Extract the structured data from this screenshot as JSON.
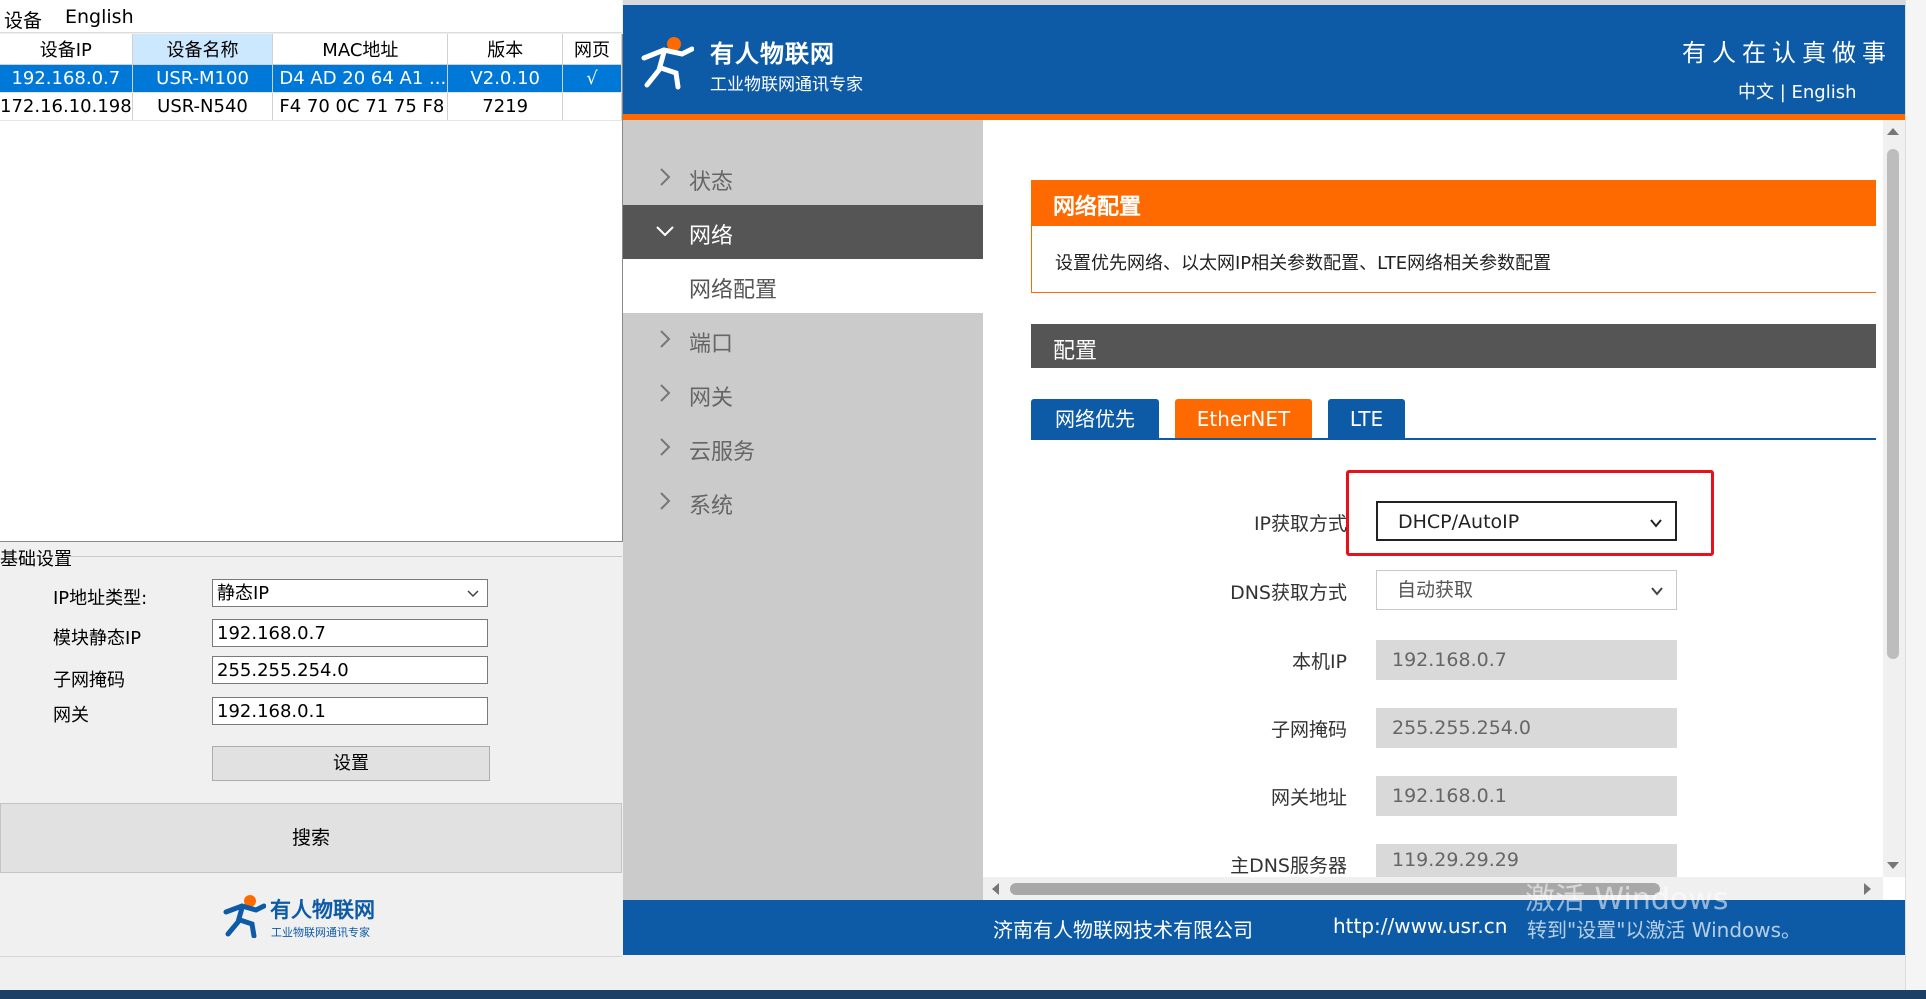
{
  "menubar": {
    "device": "设备",
    "english": "English"
  },
  "device_table": {
    "headers": [
      "设备IP",
      "设备名称",
      "MAC地址",
      "版本",
      "网页"
    ],
    "rows": [
      [
        "192.168.0.7",
        "USR-M100",
        "D4 AD 20 64 A1 ...",
        "V2.0.10",
        "√"
      ],
      [
        "172.16.10.198",
        "USR-N540",
        "F4 70 0C 71 75 F8",
        "7219",
        ""
      ]
    ]
  },
  "basic": {
    "title": "基础设置",
    "ip_type_label": "IP地址类型:",
    "ip_type_value": "静态IP",
    "static_ip_label": "模块静态IP",
    "static_ip_value": "192.168.0.7",
    "subnet_label": "子网掩码",
    "subnet_value": "255.255.254.0",
    "gateway_label": "网关",
    "gateway_value": "192.168.0.1",
    "set_button": "设置",
    "search_button": "搜索",
    "logo_title": "有人物联网",
    "logo_sub": "工业物联网通讯专家"
  },
  "web": {
    "brand_title": "有人物联网",
    "brand_sub": "工业物联网通讯专家",
    "slogan": "有人在认真做事",
    "lang": "中文 | English",
    "nav": {
      "status": "状态",
      "network": "网络",
      "network_config": "网络配置",
      "port": "端口",
      "gateway": "网关",
      "cloud": "云服务",
      "system": "系统"
    },
    "panel_title": "网络配置",
    "panel_desc": "设置优先网络、以太网IP相关参数配置、LTE网络相关参数配置",
    "config_title": "配置",
    "tabs": {
      "priority": "网络优先",
      "ethernet": "EtherNET",
      "lte": "LTE"
    },
    "form": {
      "ip_mode_label": "IP获取方式",
      "ip_mode_value": "DHCP/AutoIP",
      "dns_mode_label": "DNS获取方式",
      "dns_mode_value": "自动获取",
      "local_ip_label": "本机IP",
      "local_ip_value": "192.168.0.7",
      "subnet_label": "子网掩码",
      "subnet_value": "255.255.254.0",
      "gateway_label": "网关地址",
      "gateway_value": "192.168.0.1",
      "dns_label": "主DNS服务器",
      "dns_value": "119.29.29.29"
    },
    "footer_company": "济南有人物联网技术有限公司",
    "footer_url": "http://www.usr.cn",
    "watermark_line1": "激活 Windows",
    "watermark_line2": "转到\"设置\"以激活 Windows。"
  },
  "colors": {
    "brand_blue": "#0d5aa7",
    "brand_orange": "#ff6a00",
    "nav_active": "#555555",
    "selection": "#0078d7",
    "highlight_red": "#e8111a"
  }
}
